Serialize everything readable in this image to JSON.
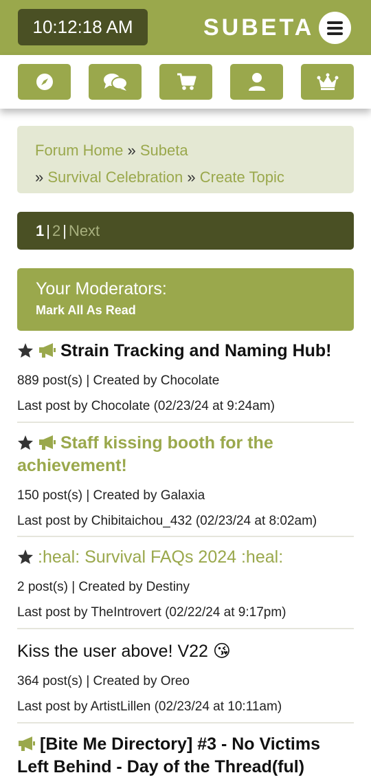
{
  "header": {
    "clock": "10:12:18 AM",
    "brand": "SUBETA"
  },
  "nav": {
    "icons": [
      "compass-icon",
      "chat-icon",
      "cart-icon",
      "user-icon",
      "crown-icon"
    ]
  },
  "breadcrumb": {
    "items": [
      "Forum Home",
      "Subeta",
      "Survival Celebration",
      "Create Topic"
    ],
    "separator": "»"
  },
  "pager": {
    "current": "1",
    "page2": "2",
    "next": "Next",
    "divider": "|"
  },
  "moderators": {
    "title": "Your Moderators:",
    "mark_read": "Mark All As Read"
  },
  "colors": {
    "accent": "#9aa84c",
    "dark": "#4a5024",
    "light": "#e4e8d3"
  },
  "topics": [
    {
      "title": "Strain Tracking and Naming Hub!",
      "posts": "889 post(s) | Created by Chocolate",
      "last": "Last post by Chocolate (02/23/24 at 9:24am)"
    },
    {
      "title": "Staff kissing booth for the achievement!",
      "posts": "150 post(s) | Created by Galaxia",
      "last": "Last post by Chibitaichou_432 (02/23/24 at 8:02am)"
    },
    {
      "title": ":heal: Survival FAQs 2024 :heal:",
      "posts": "2 post(s) | Created by Destiny",
      "last": "Last post by TheIntrovert (02/22/24 at 9:17pm)"
    },
    {
      "title": "Kiss the user above! V22 😘",
      "posts": "364 post(s) | Created by Oreo",
      "last": "Last post by ArtistLillen (02/23/24 at 10:11am)"
    },
    {
      "title": "[Bite Me Directory] #3 - No Victims Left Behind - Day of the Thread(ful)"
    }
  ]
}
